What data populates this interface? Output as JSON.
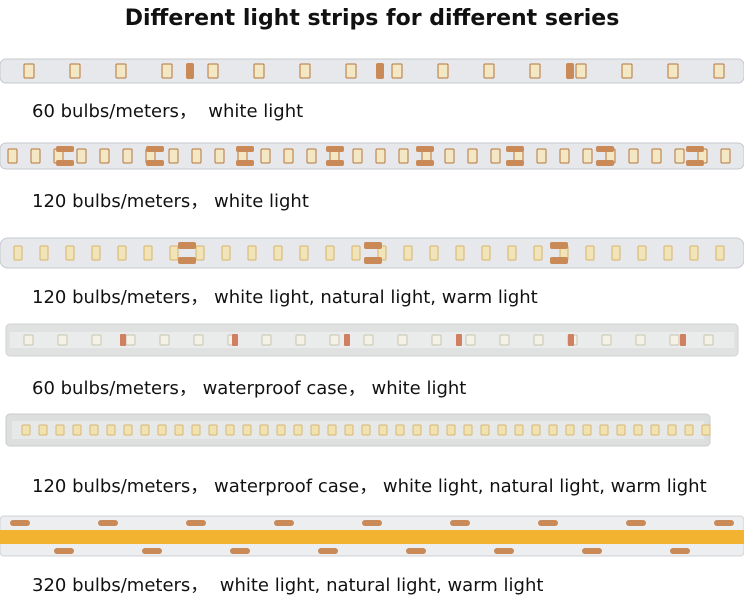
{
  "title": "Different light strips for different series",
  "strips": [
    {
      "caption": "60 bulbs/meters，  white light",
      "kind": "pcb-60"
    },
    {
      "caption": "120 bulbs/meters， white light",
      "kind": "pcb-120"
    },
    {
      "caption": "120 bulbs/meters， white light, natural light, warm light",
      "kind": "pcb-120-wide"
    },
    {
      "caption": "60 bulbs/meters， waterproof case， white light",
      "kind": "waterproof-60"
    },
    {
      "caption": "120 bulbs/meters， waterproof case， white light, natural light, warm light",
      "kind": "waterproof-120"
    },
    {
      "caption": "320 bulbs/meters，  white light, natural light, warm light",
      "kind": "cob-320"
    }
  ],
  "colors": {
    "pcb": "#e4e6ea",
    "pcb_edge": "#c9ccd2",
    "led_frame": "#b7763c",
    "led_face": "#f3e7c4",
    "pad": "#c98a58",
    "cob_base": "#eef0f2",
    "cob_band": "#f2b32a"
  }
}
